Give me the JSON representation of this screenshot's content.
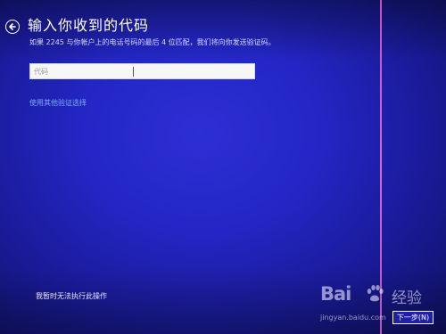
{
  "page": {
    "title": "输入你收到的代码",
    "instruction": "如果 2245 与你帐户上的电话号码的最后 4 位匹配，我们将向你发送验证码。",
    "input_placeholder": "代码"
  },
  "links": {
    "alternate_verification": "使用其他验证选择",
    "cannot_do_now": "我暂时无法执行此操作"
  },
  "buttons": {
    "next": "下一步(N)"
  },
  "icons": {
    "back": "back-arrow-icon"
  },
  "watermark": {
    "logo": "Bai",
    "logo_suffix": "经验",
    "url": "jingyan.baidu.com"
  },
  "colors": {
    "background": "#2326c4",
    "link": "#7fa8ff",
    "accent_line": "#e273d6"
  }
}
